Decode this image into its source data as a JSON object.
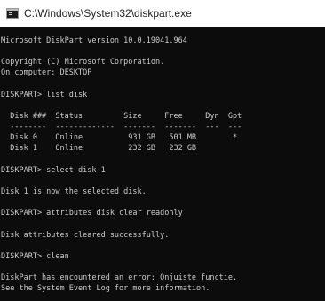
{
  "window": {
    "title": "C:\\Windows\\System32\\diskpart.exe",
    "icon": "console-window-icon"
  },
  "console": {
    "lines": [
      "Microsoft DiskPart version 10.0.19041.964",
      "",
      "Copyright (C) Microsoft Corporation.",
      "On computer: DESKTOP",
      "",
      "DISKPART> list disk",
      "",
      "  Disk ###  Status         Size     Free     Dyn  Gpt",
      "  --------  -------------  -------  -------  ---  ---",
      "  Disk 0    Online          931 GB   501 MB        *",
      "  Disk 1    Online          232 GB   232 GB",
      "",
      "DISKPART> select disk 1",
      "",
      "Disk 1 is now the selected disk.",
      "",
      "DISKPART> attributes disk clear readonly",
      "",
      "Disk attributes cleared successfully.",
      "",
      "DISKPART> clean",
      "",
      "DiskPart has encountered an error: Onjuiste functie.",
      "See the System Event Log for more information."
    ]
  }
}
